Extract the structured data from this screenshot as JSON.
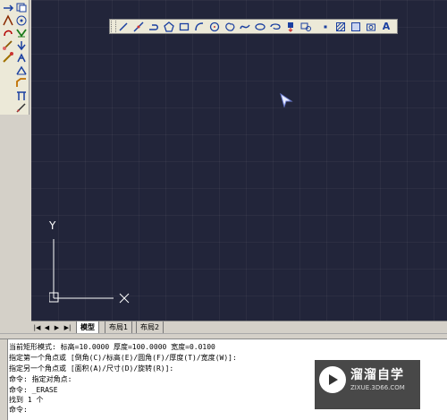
{
  "left_toolbar": {
    "icons": [
      "move-icon",
      "copy-icon",
      "offset-icon",
      "array-icon",
      "rotate-icon",
      "trim-icon",
      "mirror-icon",
      "extend-icon",
      "scale-icon",
      "stretch-icon",
      "break-icon",
      "chamfer-icon",
      "fillet-icon",
      "explode-icon"
    ]
  },
  "float_toolbar": {
    "icons": [
      "line-icon",
      "construction-line-icon",
      "polyline-icon",
      "polygon-icon",
      "rectangle-icon",
      "arc-icon",
      "circle-icon",
      "revision-cloud-icon",
      "spline-icon",
      "ellipse-icon",
      "ellipse-arc-icon",
      "insert-block-icon",
      "make-block-icon",
      "point-icon",
      "hatch-icon",
      "gradient-icon",
      "region-icon",
      "multiline-text-icon"
    ],
    "text_tool_label": "A"
  },
  "ucs": {
    "y_label": "Y",
    "x_label": "X"
  },
  "tabs": {
    "nav": [
      "|◀",
      "◀",
      "▶",
      "▶|"
    ],
    "items": [
      {
        "label": "模型",
        "active": true
      },
      {
        "label": "布局1",
        "active": false
      },
      {
        "label": "布局2",
        "active": false
      }
    ]
  },
  "command": {
    "lines": [
      "当前矩形模式:   标高=10.0000  厚度=100.0000  宽度=0.0100",
      "指定第一个角点或 [倒角(C)/标高(E)/圆角(F)/厚度(T)/宽度(W)]:",
      "指定另一个角点或 [面积(A)/尺寸(D)/旋转(R)]:",
      "命令: 指定对角点:",
      "命令: _ERASE",
      "找到 1 个",
      "命令:"
    ]
  },
  "watermark": {
    "title": "溜溜自学",
    "subtitle": "ZIXUE.3D66.COM"
  },
  "colors": {
    "canvas_bg": "#22253a",
    "toolbar_bg": "#ece9d8",
    "panel_bg": "#d4d0c8"
  }
}
